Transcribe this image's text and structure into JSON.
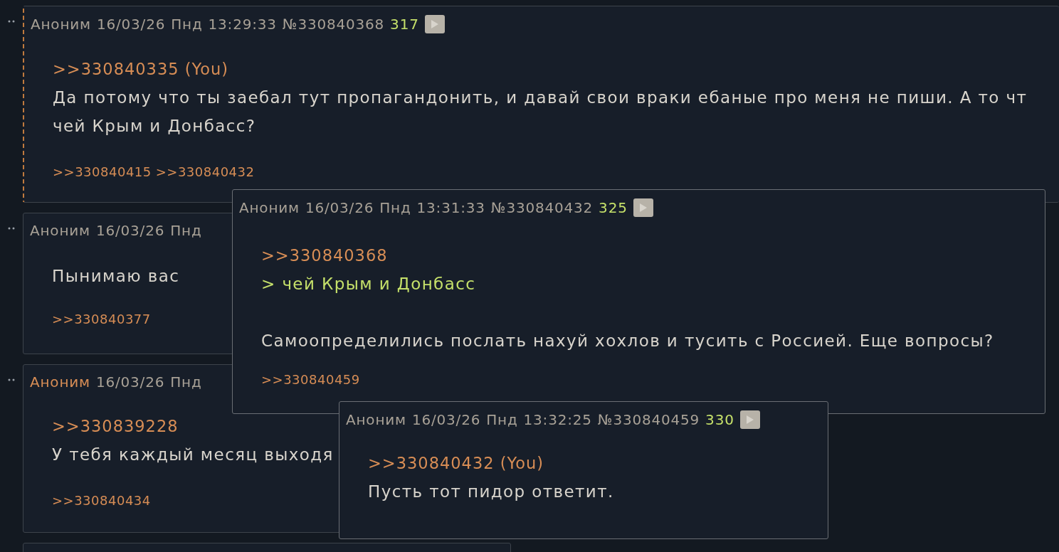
{
  "posts": [
    {
      "highlighted": true,
      "op": false,
      "header": {
        "name": "Аноним",
        "date": "16/03/26",
        "day": "Пнд",
        "time": "13:29:33",
        "number": "№330840368",
        "count": "317"
      },
      "body": [
        {
          "kind": "link",
          "text": ">>330840335 (You)"
        },
        {
          "kind": "text",
          "text": "Да потому что ты заебал тут пропагандонить, и давай свои враки ебаные про меня не пиши. А то чт"
        },
        {
          "kind": "text",
          "text": "чей Крым и Донбасс?"
        }
      ],
      "backlinks": [
        ">>330840415",
        ">>330840432"
      ]
    },
    {
      "highlighted": false,
      "op": false,
      "header": {
        "name": "Аноним",
        "date": "16/03/26",
        "day": "Пнд"
      },
      "body": [
        {
          "kind": "text",
          "text": "Пынимаю вас"
        }
      ],
      "backlinks": [
        ">>330840377"
      ]
    },
    {
      "highlighted": false,
      "op": true,
      "header": {
        "name": "Аноним",
        "date": "16/03/26",
        "day": "Пнд"
      },
      "body": [
        {
          "kind": "link",
          "text": ">>330839228"
        },
        {
          "kind": "text",
          "text": "У тебя каждый месяц выходя"
        }
      ],
      "backlinks": [
        ">>330840434"
      ]
    },
    {
      "highlighted": false
    }
  ],
  "popups": [
    {
      "header": {
        "name": "Аноним",
        "date": "16/03/26",
        "day": "Пнд",
        "time": "13:31:33",
        "number": "№330840432",
        "count": "325"
      },
      "body": [
        {
          "kind": "link",
          "text": ">>330840368"
        },
        {
          "kind": "quote",
          "text": "> чей Крым и Донбасс"
        },
        {
          "kind": "blank"
        },
        {
          "kind": "text",
          "text": "Самоопределились послать нахуй хохлов и тусить с Россией. Еще вопросы?"
        }
      ],
      "backlinks": [
        ">>330840459"
      ]
    },
    {
      "header": {
        "name": "Аноним",
        "date": "16/03/26",
        "day": "Пнд",
        "time": "13:32:25",
        "number": "№330840459",
        "count": "330"
      },
      "body": [
        {
          "kind": "link",
          "text": ">>330840432 (You)"
        },
        {
          "kind": "text",
          "text": "Пусть тот пидор ответит."
        }
      ]
    }
  ]
}
